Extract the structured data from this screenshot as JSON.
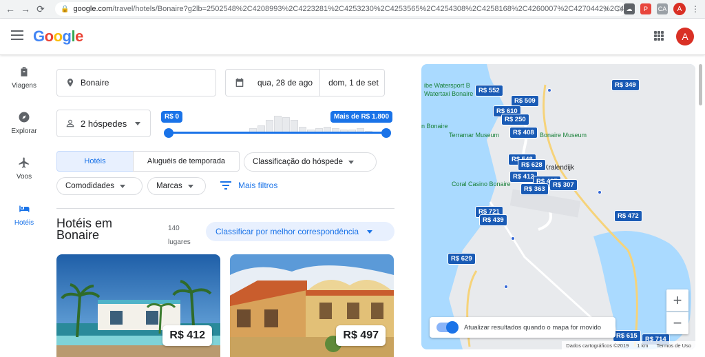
{
  "browser": {
    "url_domain": "google.com",
    "url_rest": "/travel/hotels/Bonaire?g2lb=2502548%2C4208993%2C4223281%2C4253230%2C4253565%2C4254308%2C4258168%2C4260007%2C4270442%2C4...",
    "profile_initial": "A"
  },
  "appbar": {
    "logo": "Google",
    "avatar_initial": "A"
  },
  "leftnav": [
    {
      "label": "Viagens",
      "icon": "luggage-icon"
    },
    {
      "label": "Explorar",
      "icon": "compass-icon"
    },
    {
      "label": "Voos",
      "icon": "plane-icon"
    },
    {
      "label": "Hotéis",
      "icon": "bed-icon",
      "active": true
    }
  ],
  "search": {
    "location": "Bonaire",
    "checkin": "qua, 28 de ago",
    "checkout": "dom, 1 de set",
    "guests": "2 hóspedes"
  },
  "price_slider": {
    "min_label": "R$ 0",
    "max_label": "Mais de R$ 1.800",
    "histogram": [
      3,
      5,
      9,
      12,
      11,
      9,
      4,
      2,
      3,
      4,
      3,
      2,
      2,
      3,
      1
    ]
  },
  "filters": {
    "tab_hotels": "Hotéis",
    "tab_rentals": "Aluguéis de temporada",
    "guest_rating": "Classificação do hóspede",
    "amenities": "Comodidades",
    "brands": "Marcas",
    "more_filters": "Mais filtros"
  },
  "results": {
    "title": "Hotéis em Bonaire",
    "count_line1": "140",
    "count_line2": "lugares",
    "sort": "Classificar por melhor correspondência"
  },
  "cards": [
    {
      "price": "R$ 412"
    },
    {
      "price": "R$ 497"
    }
  ],
  "map": {
    "price_tags": [
      "R$ 552",
      "R$ 509",
      "R$ 610",
      "R$ 250",
      "R$ 408",
      "R$ 349",
      "R$ 548",
      "R$ 628",
      "R$ 412",
      "R$ 497",
      "R$ 363",
      "R$ 307",
      "R$ 721",
      "R$ 439",
      "R$ 472",
      "R$ 629",
      "R$ 615",
      "R$ 714"
    ],
    "labels": [
      "Bonaire Museum",
      "Terramar Museum",
      "Kralendijk",
      "Coral Casino Bonaire",
      "Watertaxi Bonaire",
      "ibe Watersport B",
      "n Bonaire"
    ],
    "toggle_label": "Atualizar resultados quando o mapa for movido",
    "footer_data": "Dados cartográficos ©2019",
    "footer_scale": "1 km",
    "footer_terms": "Termos de Uso",
    "zoom_in": "+",
    "zoom_out": "−"
  },
  "colors": {
    "accent": "#1a73e8",
    "map_water": "#aadaff",
    "map_land": "#e8eaed",
    "map_tag": "#1a5bb5"
  }
}
